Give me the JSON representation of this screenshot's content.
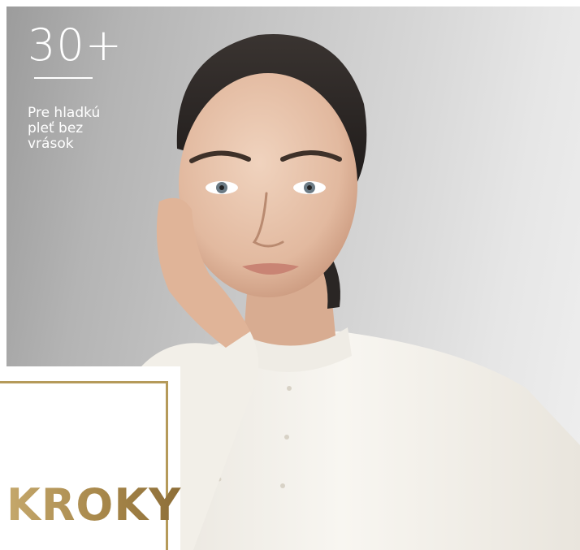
{
  "hero": {
    "age": "30+",
    "tagline": [
      "Pre hladkú",
      "pleť bez",
      "vrások"
    ]
  },
  "box": {
    "title": "KROKY"
  },
  "colors": {
    "accent_gold": "#b59a5a",
    "hair": "#2a2624",
    "skin": "#e4bfa6",
    "shirt": "#f4f1ea",
    "background": "#c8c8c8"
  }
}
